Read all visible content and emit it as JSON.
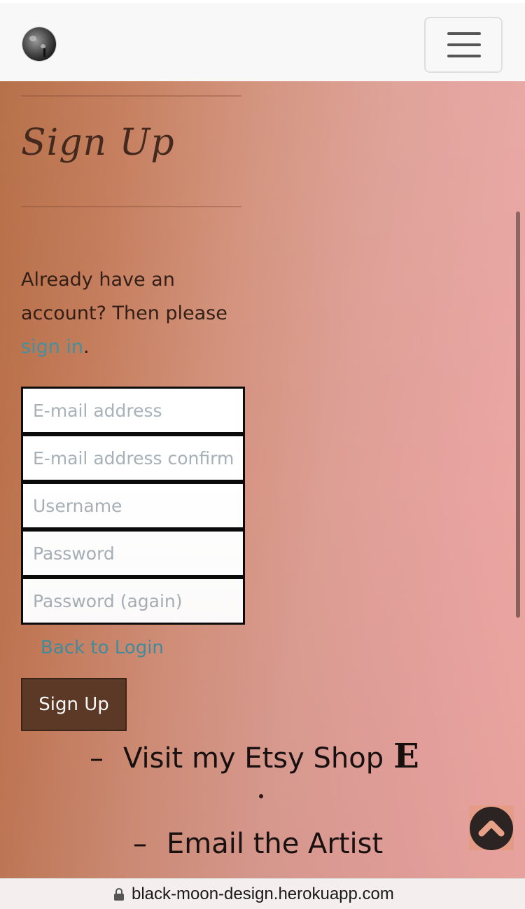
{
  "navbar": {
    "logo_icon": "moon-cactus-logo",
    "menu_icon": "hamburger-menu-icon"
  },
  "signup": {
    "title": "Sign Up",
    "intro_prefix": "Already have an account? Then please ",
    "intro_link": "sign in",
    "intro_suffix": ".",
    "fields": {
      "email_placeholder": "E-mail address",
      "email_confirm_placeholder": "E-mail address confirmation",
      "username_placeholder": "Username",
      "password_placeholder": "Password",
      "password_again_placeholder": "Password (again)"
    },
    "back_to_login": "Back to Login",
    "submit_label": "Sign Up"
  },
  "footer": {
    "etsy_dash": "–",
    "etsy_label": "Visit my Etsy Shop",
    "etsy_icon": "E",
    "email_dash": "–",
    "email_label": "Email the Artist"
  },
  "scroll_top_icon": "chevron-up-icon",
  "browser": {
    "url": "black-moon-design.herokuapp.com",
    "lock_icon": "lock-icon"
  },
  "colors": {
    "gradient_left": "#b2683f",
    "gradient_right": "#f0aaa6",
    "link": "#3f8ea0",
    "button": "#5b3a27"
  }
}
